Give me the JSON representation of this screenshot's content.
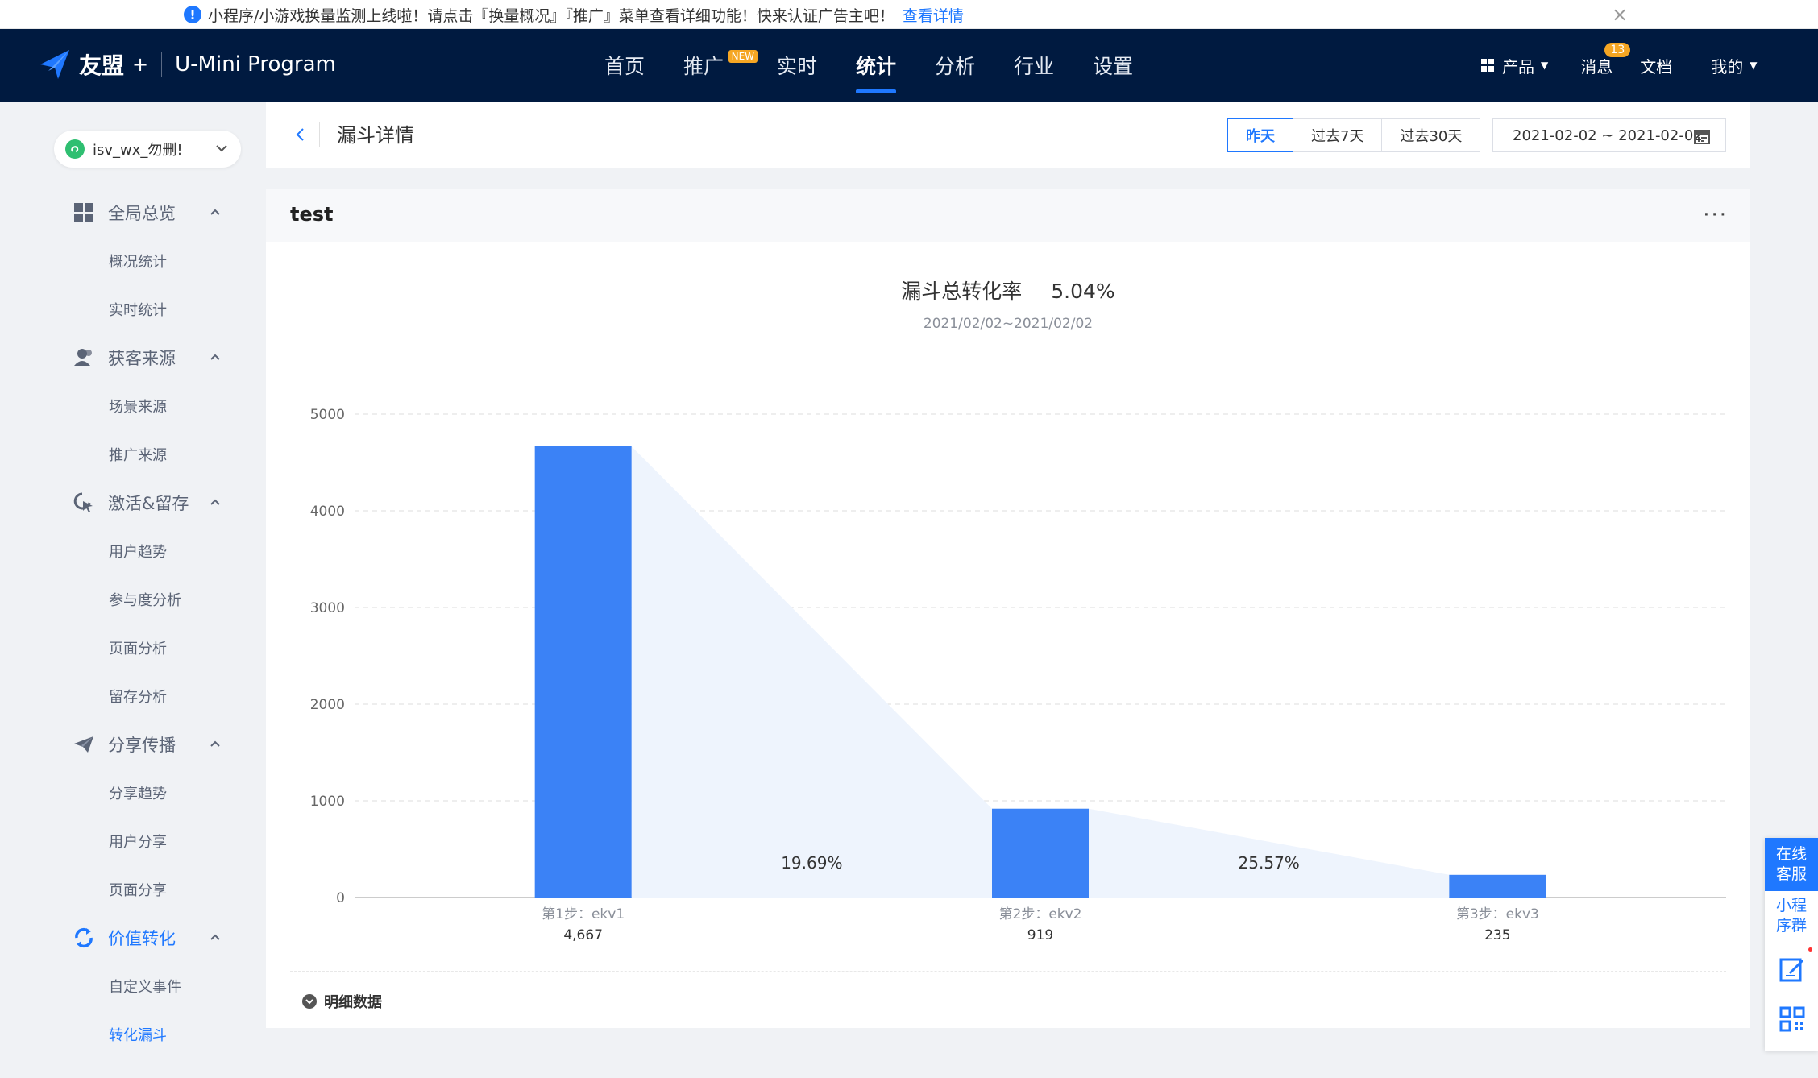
{
  "notice": {
    "text": "小程序/小游戏换量监测上线啦！请点击『换量概况』『推广』菜单查看详细功能！快来认证广告主吧！",
    "link": "查看详情"
  },
  "brand": {
    "name": "友盟",
    "plus": "+",
    "product": "U-Mini Program"
  },
  "nav": {
    "items": [
      "首页",
      "推广",
      "实时",
      "统计",
      "分析",
      "行业",
      "设置"
    ],
    "new_badge": "NEW",
    "active": "统计",
    "right": {
      "product": "产品",
      "messages": "消息",
      "message_count": "13",
      "docs": "文档",
      "mine": "我的"
    }
  },
  "app_selector": {
    "name": "isv_wx_勿删!"
  },
  "sidebar": {
    "groups": [
      {
        "label": "全局总览",
        "items": [
          "概况统计",
          "实时统计"
        ]
      },
      {
        "label": "获客来源",
        "items": [
          "场景来源",
          "推广来源"
        ]
      },
      {
        "label": "激活&留存",
        "items": [
          "用户趋势",
          "参与度分析",
          "页面分析",
          "留存分析"
        ]
      },
      {
        "label": "分享传播",
        "items": [
          "分享趋势",
          "用户分享",
          "页面分享"
        ]
      },
      {
        "label": "价值转化",
        "items": [
          "自定义事件",
          "转化漏斗"
        ]
      }
    ],
    "active_group": "价值转化",
    "active_item": "转化漏斗"
  },
  "header": {
    "title": "漏斗详情",
    "ranges": [
      "昨天",
      "过去7天",
      "过去30天"
    ],
    "active_range": "昨天",
    "date_range": "2021-02-02 ~ 2021-02-02"
  },
  "card": {
    "title": "test",
    "summary_label": "漏斗总转化率",
    "summary_value": "5.04%",
    "period": "2021/02/02~2021/02/02",
    "detail_label": "明细数据"
  },
  "chart_data": {
    "type": "bar",
    "categories": [
      "第1步：ekv1",
      "第2步：ekv2",
      "第3步：ekv3"
    ],
    "values": [
      4667,
      919,
      235
    ],
    "value_labels": [
      "4,667",
      "919",
      "235"
    ],
    "conversion_rates": [
      "19.69%",
      "25.57%"
    ],
    "ylim": [
      0,
      5000
    ],
    "yticks": [
      0,
      1000,
      2000,
      3000,
      4000,
      5000
    ],
    "grid": true,
    "colors": {
      "bar": "#3b82f6",
      "funnel_area": "#eef4fd",
      "grid": "#dddddd"
    }
  },
  "support": {
    "online": "在线客服",
    "group": "小程序群"
  },
  "colors": {
    "primary": "#1f78ff",
    "nav_bg": "#001a40",
    "badge": "#f5a623"
  }
}
